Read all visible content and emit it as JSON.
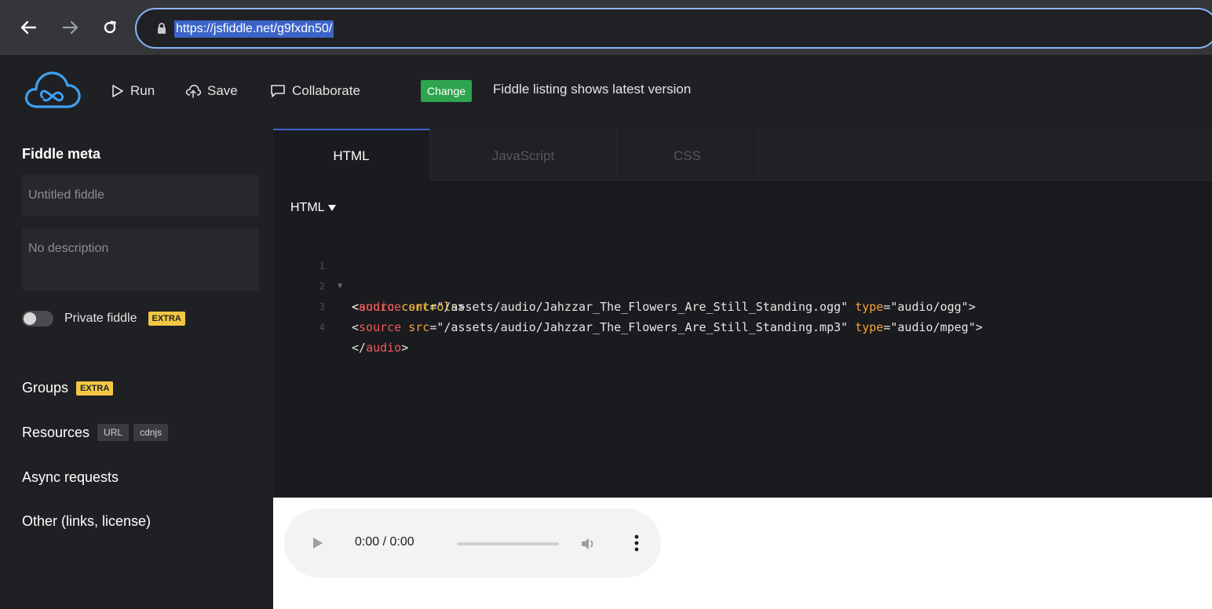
{
  "browser": {
    "url": "https://jsfiddle.net/g9fxdn50/",
    "icons": [
      "back-icon",
      "forward-icon",
      "reload-icon",
      "lock-icon"
    ]
  },
  "header": {
    "run_label": "Run",
    "save_label": "Save",
    "collaborate_label": "Collaborate",
    "change_label": "Change",
    "listing_text": "Fiddle listing shows latest version",
    "accent_green": "#2ea44f"
  },
  "sidebar": {
    "title": "Fiddle meta",
    "name_placeholder": "Untitled fiddle",
    "description_placeholder": "No description",
    "private_label": "Private fiddle",
    "extra_badge": "EXTRA",
    "groups_label": "Groups",
    "resources_label": "Resources",
    "resources_badges": [
      "URL",
      "cdnjs"
    ],
    "async_label": "Async requests",
    "other_label": "Other (links, license)"
  },
  "editor": {
    "tabs": [
      "HTML",
      "JavaScript",
      "CSS"
    ],
    "active_tab": "HTML",
    "language_select": "HTML",
    "lines": [
      {
        "num": "1",
        "parts": [
          "<",
          "audio",
          " ",
          "controls",
          ">"
        ]
      },
      {
        "num": "2",
        "parts": [
          "<",
          "source",
          " ",
          "src",
          "=",
          "\"/assets/audio/Jahzzar_The_Flowers_Are_Still_Standing.ogg\"",
          " ",
          "type",
          "=",
          "\"audio/ogg\"",
          ">"
        ]
      },
      {
        "num": "3",
        "parts": [
          "<",
          "source",
          " ",
          "src",
          "=",
          "\"/assets/audio/Jahzzar_The_Flowers_Are_Still_Standing.mp3\"",
          " ",
          "type",
          "=",
          "\"audio/mpeg\"",
          ">"
        ]
      },
      {
        "num": "4",
        "parts": [
          "</",
          "audio",
          ">"
        ]
      }
    ]
  },
  "result": {
    "time_display": "0:00 / 0:00",
    "icons": [
      "play-icon",
      "volume-icon",
      "more-options-icon"
    ]
  }
}
